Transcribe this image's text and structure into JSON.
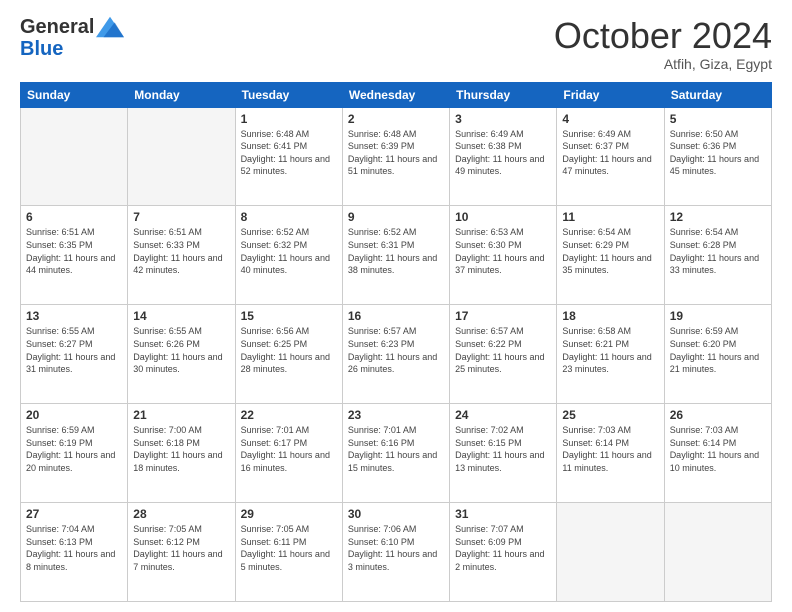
{
  "logo": {
    "general": "General",
    "blue": "Blue"
  },
  "header": {
    "month": "October 2024",
    "location": "Atfih, Giza, Egypt"
  },
  "weekdays": [
    "Sunday",
    "Monday",
    "Tuesday",
    "Wednesday",
    "Thursday",
    "Friday",
    "Saturday"
  ],
  "weeks": [
    [
      {
        "day": "",
        "info": ""
      },
      {
        "day": "",
        "info": ""
      },
      {
        "day": "1",
        "info": "Sunrise: 6:48 AM\nSunset: 6:41 PM\nDaylight: 11 hours and 52 minutes."
      },
      {
        "day": "2",
        "info": "Sunrise: 6:48 AM\nSunset: 6:39 PM\nDaylight: 11 hours and 51 minutes."
      },
      {
        "day": "3",
        "info": "Sunrise: 6:49 AM\nSunset: 6:38 PM\nDaylight: 11 hours and 49 minutes."
      },
      {
        "day": "4",
        "info": "Sunrise: 6:49 AM\nSunset: 6:37 PM\nDaylight: 11 hours and 47 minutes."
      },
      {
        "day": "5",
        "info": "Sunrise: 6:50 AM\nSunset: 6:36 PM\nDaylight: 11 hours and 45 minutes."
      }
    ],
    [
      {
        "day": "6",
        "info": "Sunrise: 6:51 AM\nSunset: 6:35 PM\nDaylight: 11 hours and 44 minutes."
      },
      {
        "day": "7",
        "info": "Sunrise: 6:51 AM\nSunset: 6:33 PM\nDaylight: 11 hours and 42 minutes."
      },
      {
        "day": "8",
        "info": "Sunrise: 6:52 AM\nSunset: 6:32 PM\nDaylight: 11 hours and 40 minutes."
      },
      {
        "day": "9",
        "info": "Sunrise: 6:52 AM\nSunset: 6:31 PM\nDaylight: 11 hours and 38 minutes."
      },
      {
        "day": "10",
        "info": "Sunrise: 6:53 AM\nSunset: 6:30 PM\nDaylight: 11 hours and 37 minutes."
      },
      {
        "day": "11",
        "info": "Sunrise: 6:54 AM\nSunset: 6:29 PM\nDaylight: 11 hours and 35 minutes."
      },
      {
        "day": "12",
        "info": "Sunrise: 6:54 AM\nSunset: 6:28 PM\nDaylight: 11 hours and 33 minutes."
      }
    ],
    [
      {
        "day": "13",
        "info": "Sunrise: 6:55 AM\nSunset: 6:27 PM\nDaylight: 11 hours and 31 minutes."
      },
      {
        "day": "14",
        "info": "Sunrise: 6:55 AM\nSunset: 6:26 PM\nDaylight: 11 hours and 30 minutes."
      },
      {
        "day": "15",
        "info": "Sunrise: 6:56 AM\nSunset: 6:25 PM\nDaylight: 11 hours and 28 minutes."
      },
      {
        "day": "16",
        "info": "Sunrise: 6:57 AM\nSunset: 6:23 PM\nDaylight: 11 hours and 26 minutes."
      },
      {
        "day": "17",
        "info": "Sunrise: 6:57 AM\nSunset: 6:22 PM\nDaylight: 11 hours and 25 minutes."
      },
      {
        "day": "18",
        "info": "Sunrise: 6:58 AM\nSunset: 6:21 PM\nDaylight: 11 hours and 23 minutes."
      },
      {
        "day": "19",
        "info": "Sunrise: 6:59 AM\nSunset: 6:20 PM\nDaylight: 11 hours and 21 minutes."
      }
    ],
    [
      {
        "day": "20",
        "info": "Sunrise: 6:59 AM\nSunset: 6:19 PM\nDaylight: 11 hours and 20 minutes."
      },
      {
        "day": "21",
        "info": "Sunrise: 7:00 AM\nSunset: 6:18 PM\nDaylight: 11 hours and 18 minutes."
      },
      {
        "day": "22",
        "info": "Sunrise: 7:01 AM\nSunset: 6:17 PM\nDaylight: 11 hours and 16 minutes."
      },
      {
        "day": "23",
        "info": "Sunrise: 7:01 AM\nSunset: 6:16 PM\nDaylight: 11 hours and 15 minutes."
      },
      {
        "day": "24",
        "info": "Sunrise: 7:02 AM\nSunset: 6:15 PM\nDaylight: 11 hours and 13 minutes."
      },
      {
        "day": "25",
        "info": "Sunrise: 7:03 AM\nSunset: 6:14 PM\nDaylight: 11 hours and 11 minutes."
      },
      {
        "day": "26",
        "info": "Sunrise: 7:03 AM\nSunset: 6:14 PM\nDaylight: 11 hours and 10 minutes."
      }
    ],
    [
      {
        "day": "27",
        "info": "Sunrise: 7:04 AM\nSunset: 6:13 PM\nDaylight: 11 hours and 8 minutes."
      },
      {
        "day": "28",
        "info": "Sunrise: 7:05 AM\nSunset: 6:12 PM\nDaylight: 11 hours and 7 minutes."
      },
      {
        "day": "29",
        "info": "Sunrise: 7:05 AM\nSunset: 6:11 PM\nDaylight: 11 hours and 5 minutes."
      },
      {
        "day": "30",
        "info": "Sunrise: 7:06 AM\nSunset: 6:10 PM\nDaylight: 11 hours and 3 minutes."
      },
      {
        "day": "31",
        "info": "Sunrise: 7:07 AM\nSunset: 6:09 PM\nDaylight: 11 hours and 2 minutes."
      },
      {
        "day": "",
        "info": ""
      },
      {
        "day": "",
        "info": ""
      }
    ]
  ]
}
